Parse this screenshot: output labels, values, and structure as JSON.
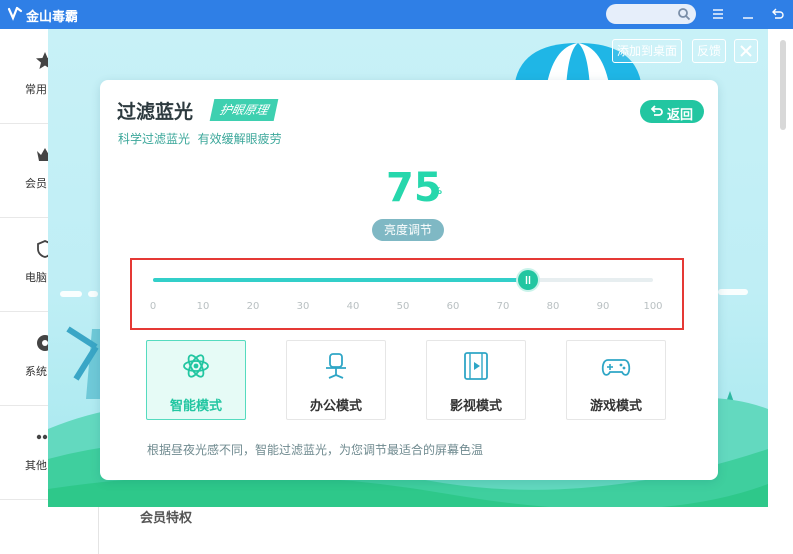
{
  "app": {
    "title": "金山毒霸"
  },
  "sidebar": {
    "items": [
      {
        "label": "常用",
        "icon": "star-icon"
      },
      {
        "label": "会员",
        "icon": "crown-icon"
      },
      {
        "label": "电脑",
        "icon": "shield-icon"
      },
      {
        "label": "系统",
        "icon": "gear-icon"
      },
      {
        "label": "其他",
        "icon": "more-dots-icon"
      }
    ]
  },
  "background": {
    "bottom_text": "会员特权"
  },
  "header": {
    "add_to_desktop": "添加到桌面",
    "feedback": "反馈"
  },
  "panel": {
    "title": "过滤蓝光",
    "principle_tag": "护眼原理",
    "subtitle": "科学过滤蓝光  有效缓解眼疲劳",
    "back_label": "返回",
    "value": "75",
    "unit": "%",
    "adjust_label": "亮度调节",
    "slider": {
      "min": 0,
      "max": 100,
      "value": 75,
      "ticks": [
        "0",
        "10",
        "20",
        "30",
        "40",
        "50",
        "60",
        "70",
        "80",
        "90",
        "100"
      ]
    },
    "modes": [
      {
        "label": "智能模式",
        "icon": "atom-icon",
        "active": true
      },
      {
        "label": "办公模式",
        "icon": "office-chair-icon",
        "active": false
      },
      {
        "label": "影视模式",
        "icon": "film-icon",
        "active": false
      },
      {
        "label": "游戏模式",
        "icon": "gamepad-icon",
        "active": false
      }
    ],
    "hint": "根据昼夜光感不同，智能过滤蓝光，为您调节最适合的屏幕色温"
  },
  "colors": {
    "accent": "#22c6a1",
    "titlebar": "#2f7fe6",
    "highlight_border": "#e53935"
  }
}
